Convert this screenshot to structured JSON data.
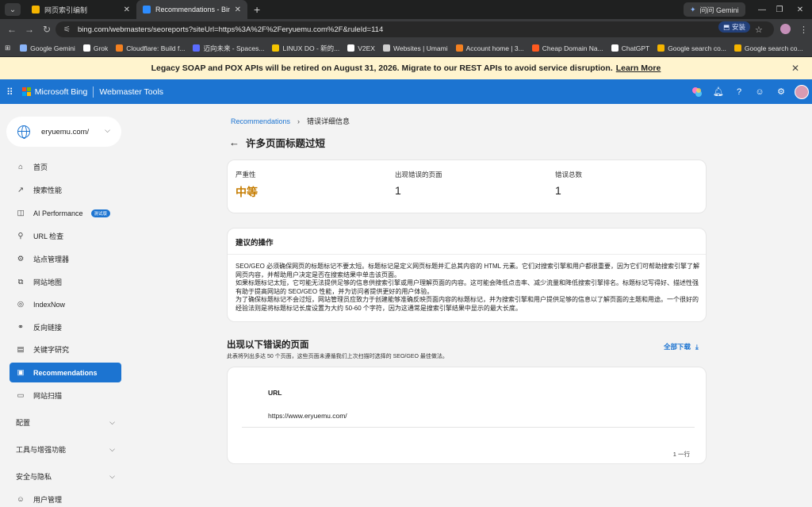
{
  "browser": {
    "tabs": [
      {
        "title": "网页索引编制",
        "active": false,
        "favicon_color": "#f4b400"
      },
      {
        "title": "Recommendations - Bing W...",
        "active": true,
        "favicon_color": "#2d8cff"
      }
    ],
    "gemini_chip": "问问 Gemini",
    "url": "bing.com/webmasters/seoreports?siteUrl=https%3A%2F%2Feryuemu.com%2F&ruleId=114",
    "install_label": "安装",
    "bookmarks": [
      {
        "label": "Google Gemini",
        "icon_color": "#8ab4f8"
      },
      {
        "label": "Grok",
        "icon_color": "#ffffff"
      },
      {
        "label": "Cloudflare: Build f...",
        "icon_color": "#f38020"
      },
      {
        "label": "迈向未来 - Spaces...",
        "icon_color": "#5b6cff"
      },
      {
        "label": "LINUX DO - 新的...",
        "icon_color": "#f4c400"
      },
      {
        "label": "V2EX",
        "icon_color": "#ffffff"
      },
      {
        "label": "Websites | Umami",
        "icon_color": "#cfcfcf"
      },
      {
        "label": "Account home | 3...",
        "icon_color": "#f38020"
      },
      {
        "label": "Cheap Domain Na...",
        "icon_color": "#ff5a1f"
      },
      {
        "label": "ChatGPT",
        "icon_color": "#ffffff"
      },
      {
        "label": "Google search co...",
        "icon_color": "#f4b400"
      },
      {
        "label": "Google search co...",
        "icon_color": "#f4b400"
      }
    ]
  },
  "banner": {
    "text": "Legacy SOAP and POX APIs will be retired on August 31, 2026. Migrate to our REST APIs to avoid service disruption.",
    "link": "Learn More"
  },
  "appbar": {
    "brand": "Microsoft Bing",
    "product": "Webmaster Tools",
    "ms_colors": [
      "#f25022",
      "#7fba00",
      "#00a4ef",
      "#ffb900"
    ]
  },
  "sidebar": {
    "site": "eryuemu.com/",
    "items": [
      {
        "label": "首页",
        "icon": "home-icon",
        "glyph": "⌂"
      },
      {
        "label": "搜索性能",
        "icon": "trend-icon",
        "glyph": "↗"
      },
      {
        "label": "AI Performance",
        "icon": "ai-performance-icon",
        "glyph": "◫",
        "badge": "测试版"
      },
      {
        "label": "URL 检查",
        "icon": "url-inspect-icon",
        "glyph": "⚲"
      },
      {
        "label": "站点管理器",
        "icon": "site-manager-icon",
        "glyph": "⚙"
      },
      {
        "label": "网站地图",
        "icon": "sitemap-icon",
        "glyph": "⧉"
      },
      {
        "label": "IndexNow",
        "icon": "indexnow-icon",
        "glyph": "◎"
      },
      {
        "label": "反向链接",
        "icon": "backlink-icon",
        "glyph": "⚭"
      },
      {
        "label": "关键字研究",
        "icon": "keyword-icon",
        "glyph": "▤"
      },
      {
        "label": "Recommendations",
        "icon": "recommendations-icon",
        "glyph": "▣",
        "active": true
      },
      {
        "label": "网站扫描",
        "icon": "site-scan-icon",
        "glyph": "▭"
      }
    ],
    "groups": [
      {
        "label": "配置"
      },
      {
        "label": "工具与增强功能"
      },
      {
        "label": "安全与隐私"
      }
    ],
    "last_item": {
      "label": "用户管理",
      "icon": "user-management-icon",
      "glyph": "☺"
    }
  },
  "main": {
    "breadcrumb": {
      "parent": "Recommendations",
      "current": "错误详细信息"
    },
    "title": "许多页面标题过短",
    "stats": [
      {
        "label": "严重性",
        "value": "中等"
      },
      {
        "label": "出现错误的页面",
        "value": "1"
      },
      {
        "label": "错误总数",
        "value": "1"
      }
    ],
    "action": {
      "heading": "建议的操作",
      "paragraphs": [
        "SEO/GEO 必须确保网页的标题标记不要太短。标题标记是定义网页标题并汇总其内容的 HTML 元素。它们对搜索引擎和用户都很重要，因为它们可帮助搜索引擎了解网页内容，并帮助用户决定是否在搜索结果中单击该页面。",
        "如果标题标记太短，它可能无法提供足够的信息供搜索引擎或用户理解页面的内容。这可能会降低点击率、减少流量和降低搜索引擎排名。标题标记写得好、描述性强有助于提高网站的 SEO/GEO 性能，并为访问者提供更好的用户体验。",
        "为了确保标题标记不会过短，网站管理员应致力于创建能够准确反映页面内容的标题标记，并为搜索引擎和用户提供足够的信息以了解页面的主题和用途。一个很好的经验法则是将标题标记长度设置为大约 50-60 个字符，因为这通常是搜索引擎结果中显示的最大长度。"
      ]
    },
    "errors": {
      "title": "出现以下错误的页面",
      "subtitle": "此表将列出多达 50 个页面，这些页面未遵循我们上次扫描时选择的 SEO/GEO 最佳做法。",
      "download": "全部下载",
      "column": "URL",
      "rows": [
        "https://www.eryuemu.com/"
      ],
      "count": "1 一行"
    }
  }
}
